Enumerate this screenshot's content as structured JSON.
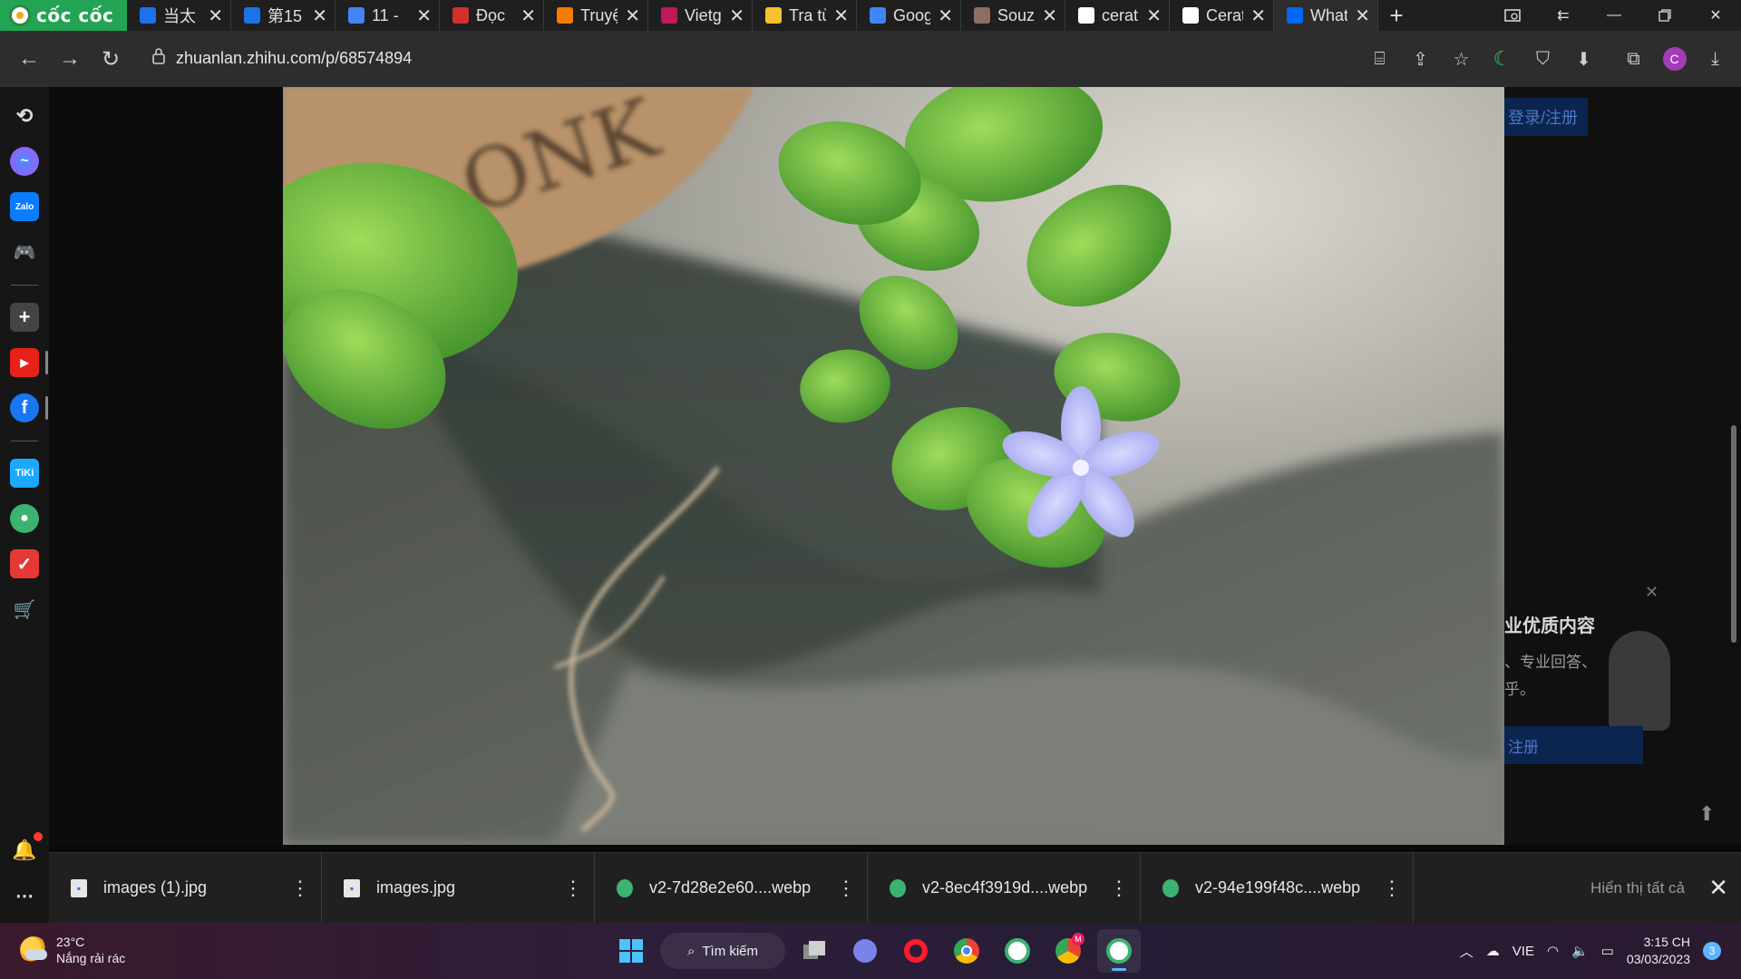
{
  "browser": {
    "brand": "cốc cốc",
    "tabs": [
      {
        "label": "当太",
        "favicon": "zhihu-z-icon",
        "color": "#1a73e8"
      },
      {
        "label": "第15",
        "favicon": "zhihu-z-icon",
        "color": "#1a73e8"
      },
      {
        "label": "11 - ",
        "favicon": "docs-icon",
        "color": "#4285f4"
      },
      {
        "label": "Đọc",
        "favicon": "book-icon",
        "color": "#d32f2f"
      },
      {
        "label": "Truyệ",
        "favicon": "w-icon",
        "color": "#f57c00"
      },
      {
        "label": "Vietg",
        "favicon": "hand-icon",
        "color": "#c2185b"
      },
      {
        "label": "Tra từ",
        "favicon": "dict-icon",
        "color": "#fbc02d"
      },
      {
        "label": "Goog",
        "favicon": "translate-icon",
        "color": "#4285f4"
      },
      {
        "label": "Souz",
        "favicon": "avatar-icon",
        "color": "#8d6e63"
      },
      {
        "label": "cerat",
        "favicon": "google-icon",
        "color": "#ffffff"
      },
      {
        "label": "Cerat",
        "favicon": "google-icon",
        "color": "#ffffff"
      },
      {
        "label": "What",
        "favicon": "zhihu-icon",
        "color": "#0066ff",
        "active": true
      }
    ],
    "url": "zhuanlan.zhihu.com/p/68574894"
  },
  "zhihu": {
    "login": "登录/注册",
    "promo_title": "业优质内容",
    "promo_line1": "、专业回答、",
    "promo_line2": "乎。",
    "register": "注册"
  },
  "downloads": {
    "items": [
      {
        "name": "images (1).jpg",
        "icon": "image-file-icon"
      },
      {
        "name": "images.jpg",
        "icon": "image-file-icon"
      },
      {
        "name": "v2-7d28e2e60....webp",
        "icon": "coccoc-file-icon"
      },
      {
        "name": "v2-8ec4f3919d....webp",
        "icon": "coccoc-file-icon"
      },
      {
        "name": "v2-94e199f48c....webp",
        "icon": "coccoc-file-icon"
      }
    ],
    "show_all": "Hiển thị tất cả"
  },
  "taskbar": {
    "temperature": "23°C",
    "weather": "Nắng rải rác",
    "search_label": "Tìm kiếm",
    "language": "VIE",
    "time": "3:15 CH",
    "date": "03/03/2023",
    "notification_count": "3"
  }
}
